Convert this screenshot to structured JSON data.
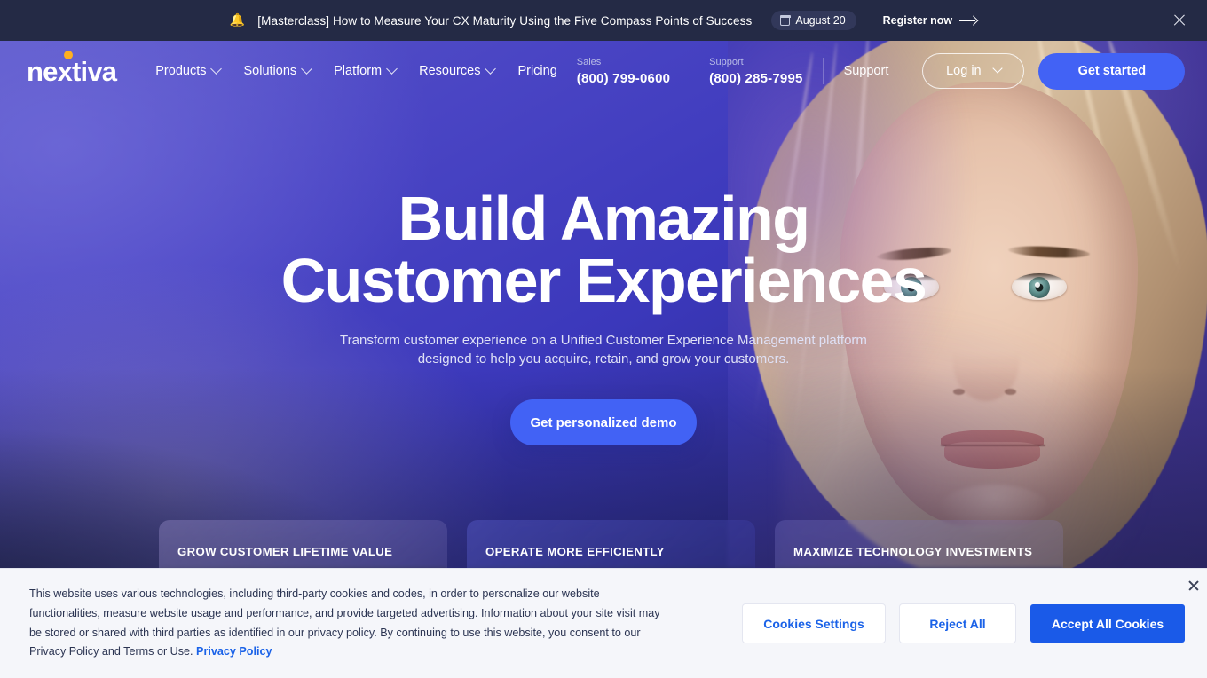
{
  "announcement": {
    "bell_icon": "bell-icon",
    "text": "[Masterclass] How to Measure Your CX Maturity Using the Five Compass Points of Success",
    "date_label": "August 20",
    "register_label": "Register now",
    "close_label": "×"
  },
  "nav": {
    "logo_text": "nextiva",
    "links": [
      {
        "label": "Products",
        "has_chevron": true
      },
      {
        "label": "Solutions",
        "has_chevron": true
      },
      {
        "label": "Platform",
        "has_chevron": true
      },
      {
        "label": "Resources",
        "has_chevron": true
      },
      {
        "label": "Pricing",
        "has_chevron": false
      }
    ],
    "sales": {
      "label": "Sales",
      "number": "(800) 799-0600"
    },
    "support_phone": {
      "label": "Support",
      "number": "(800) 285-7995"
    },
    "support_link": "Support",
    "login_label": "Log in",
    "get_started_label": "Get started"
  },
  "hero": {
    "title_line1": "Build Amazing",
    "title_line2": "Customer Experiences",
    "subtitle": "Transform customer experience on a Unified Customer Experience Management platform designed to help you acquire, retain, and grow your customers.",
    "cta_label": "Get personalized demo",
    "cards": [
      {
        "label": "GROW CUSTOMER LIFETIME VALUE"
      },
      {
        "label": "OPERATE MORE EFFICIENTLY"
      },
      {
        "label": "MAXIMIZE TECHNOLOGY INVESTMENTS"
      }
    ]
  },
  "cookie_banner": {
    "body_part1": "This website uses various technologies, including third-party cookies and codes, in order to personalize our website functionalities, measure website usage and performance, and provide targeted advertising. Information about your site visit may be stored or shared with third parties as identified in our privacy policy. By continuing to use this website, you consent to our Privacy Policy and Terms or Use.",
    "privacy_link": "Privacy Policy",
    "settings_label": "Cookies Settings",
    "reject_label": "Reject All",
    "accept_label": "Accept All Cookies"
  },
  "colors": {
    "brand_blue": "#4262f5",
    "accent_orange": "#ffb020",
    "banner_dark": "#242a45",
    "cookie_bg": "#f5f6fa",
    "cookie_link": "#1a62e8",
    "cookie_accept": "#1a5ae8"
  }
}
